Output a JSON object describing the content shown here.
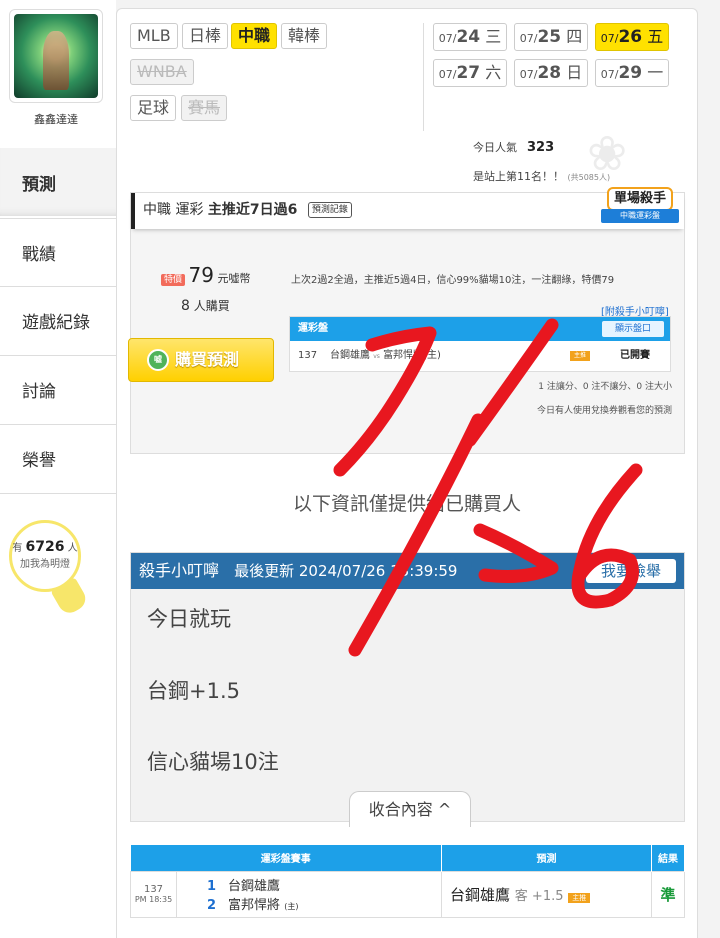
{
  "sidebar": {
    "username": "鑫鑫達達",
    "items": [
      {
        "label": "預測"
      },
      {
        "label": "戰績"
      },
      {
        "label": "遊戲紀錄"
      },
      {
        "label": "討論"
      },
      {
        "label": "榮譽"
      }
    ],
    "fans": {
      "prefix": "有",
      "count": "6726",
      "suffix": "人",
      "caption": "加我為明燈"
    }
  },
  "leagues": [
    {
      "label": "MLB"
    },
    {
      "label": "日棒"
    },
    {
      "label": "中職"
    },
    {
      "label": "韓棒"
    },
    {
      "label": "WNBA"
    },
    {
      "label": "足球"
    },
    {
      "label": "賽馬"
    }
  ],
  "dates": [
    {
      "md": "07/",
      "day": "24",
      "wd": "三"
    },
    {
      "md": "07/",
      "day": "25",
      "wd": "四"
    },
    {
      "md": "07/",
      "day": "26",
      "wd": "五"
    },
    {
      "md": "07/",
      "day": "27",
      "wd": "六"
    },
    {
      "md": "07/",
      "day": "28",
      "wd": "日"
    },
    {
      "md": "07/",
      "day": "29",
      "wd": "一"
    }
  ],
  "popularity": {
    "label": "今日人氣",
    "value": "323",
    "rank": "是站上第11名！！",
    "rank_note": "(共5085人)"
  },
  "prediction": {
    "title_league": "中職 運彩",
    "title_main": "主推近7日過6",
    "record_button": "預測記錄",
    "badge_title": "單場殺手",
    "badge_sub": "中職運彩盤",
    "special_label": "特價",
    "price": "79",
    "price_unit": "元噓幣",
    "buyers_count": "8",
    "buyers_label": "人購買",
    "buy_button": "購買預測",
    "summary": "上次2過2全過，主推近5過4日，信心99%貓場10注，一注翻綠，特價79",
    "killer_link": "[附殺手小叮嚀]",
    "table_title": "運彩盤",
    "show_button": "顯示盤口",
    "game_no": "137",
    "teams": "台鋼雄鷹",
    "vs": "vs",
    "home": "富邦悍將(主)",
    "host_tag": "主推",
    "status": "已開賽",
    "stat1": "1 注讓分、0 注不讓分、0 注大小",
    "stat2": "今日有人使用兌換券觀看您的預測"
  },
  "notice": "以下資訊僅提供給已購買人",
  "notes": {
    "title": "殺手小叮嚀",
    "updated": "最後更新 2024/07/26 13:39:59",
    "report_button": "我要檢舉",
    "lines": [
      "今日就玩",
      "台鋼+1.5",
      "信心貓場10注"
    ],
    "collapse_label": "收合內容 ^"
  },
  "results_table": {
    "headers": [
      "運彩盤賽事",
      "預測",
      "結果"
    ],
    "game_no": "137",
    "time": "PM 18:35",
    "team1_no": "1",
    "team1": "台鋼雄鷹",
    "team2_no": "2",
    "team2": "富邦悍將",
    "team2_tag": "(主)",
    "pick": "台鋼雄鷹",
    "pick_side": "客 +1.5",
    "pick_tag": "主推",
    "result": "準"
  },
  "annotation_color": "#e8171f"
}
